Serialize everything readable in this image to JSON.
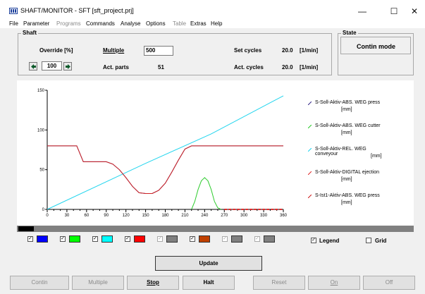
{
  "window": {
    "title": "SHAFT/MONITOR - SFT  [sft_project.prj]",
    "minimize": "—",
    "maximize": "☐",
    "close": "✕"
  },
  "menu": [
    {
      "label": "File",
      "enabled": true
    },
    {
      "label": "Parameter",
      "enabled": true
    },
    {
      "label": "Programs",
      "enabled": false
    },
    {
      "label": "Commands",
      "enabled": true
    },
    {
      "label": "Analyse",
      "enabled": true
    },
    {
      "label": "Options",
      "enabled": true
    },
    {
      "label": "Table",
      "enabled": false
    },
    {
      "label": "Extras",
      "enabled": true
    },
    {
      "label": "Help",
      "enabled": true
    }
  ],
  "shaft": {
    "group_label": "Shaft",
    "override_label": "Override [%]",
    "override_value": "100",
    "multiple_label": "Multiple",
    "multiple_value": "500",
    "act_parts_label": "Act. parts",
    "act_parts_value": "51",
    "set_cycles_label": "Set cycles",
    "set_cycles_value": "20.0",
    "set_cycles_unit": "[1/min]",
    "act_cycles_label": "Act. cycles",
    "act_cycles_value": "20.0",
    "act_cycles_unit": "[1/min]"
  },
  "state": {
    "group_label": "State",
    "value": "Contin mode"
  },
  "chart_data": {
    "type": "line",
    "xlim": [
      0,
      360
    ],
    "ylim": [
      0,
      150
    ],
    "x_ticks": [
      "0",
      "30",
      "60",
      "90",
      "120",
      "150",
      "180",
      "210",
      "240",
      "270",
      "300",
      "330",
      "360"
    ],
    "y_ticks": [
      "0",
      "50",
      "100",
      "150"
    ],
    "grid": false,
    "legend_position": "right",
    "series": [
      {
        "name": "S-Soll-Aktiv-ABS. WEG press",
        "unit": "[mm]",
        "color": "#3a2e8c",
        "x": [
          0,
          45,
          55,
          90,
          100,
          110,
          120,
          130,
          140,
          150,
          160,
          170,
          180,
          190,
          200,
          210,
          220,
          360
        ],
        "y": [
          80,
          80,
          60,
          60,
          57,
          50,
          40,
          29,
          21,
          20,
          20,
          24,
          33,
          47,
          62,
          76,
          80,
          80
        ]
      },
      {
        "name": "S-Soll-Aktiv-ABS. WEG cutter",
        "unit": "[mm]",
        "color": "#2ecc2e",
        "x": [
          220,
          225,
          230,
          235,
          240,
          245,
          250,
          255,
          260,
          265
        ],
        "y": [
          0,
          10,
          25,
          36,
          40,
          36,
          25,
          10,
          2,
          0
        ]
      },
      {
        "name": "S-Soll-Aktiv-REL. WEG conveyour",
        "unit": "[mm]",
        "color": "#22d5ee",
        "x": [
          0,
          150,
          250,
          360
        ],
        "y": [
          0,
          58,
          95,
          143
        ]
      },
      {
        "name": "S-Soll-Aktiv-DIGITAL ejection",
        "unit": "[mm]",
        "color": "#e03030",
        "x": [
          0,
          360
        ],
        "y": [
          0,
          0
        ]
      },
      {
        "name": "S-Ist1-Aktiv-ABS. WEG press",
        "unit": "[mm]",
        "color": "#d02020",
        "x": [
          0,
          45,
          55,
          90,
          100,
          110,
          120,
          130,
          140,
          150,
          160,
          170,
          180,
          190,
          200,
          210,
          220,
          360
        ],
        "y": [
          80,
          80,
          60,
          60,
          57,
          50,
          40,
          29,
          21,
          20,
          20,
          24,
          33,
          47,
          62,
          76,
          80,
          80
        ]
      }
    ]
  },
  "channels": [
    {
      "checked": true,
      "enabled": true,
      "color": "#0000ff"
    },
    {
      "checked": true,
      "enabled": true,
      "color": "#00ff00"
    },
    {
      "checked": true,
      "enabled": true,
      "color": "#00ffff"
    },
    {
      "checked": true,
      "enabled": true,
      "color": "#ff0000"
    },
    {
      "checked": true,
      "enabled": false,
      "color": "#808080"
    },
    {
      "checked": true,
      "enabled": true,
      "color": "#c04000"
    },
    {
      "checked": true,
      "enabled": false,
      "color": "#808080"
    },
    {
      "checked": true,
      "enabled": false,
      "color": "#808080"
    }
  ],
  "options": {
    "legend_label": "Legend",
    "legend_checked": true,
    "grid_label": "Grid",
    "grid_checked": false
  },
  "buttons": {
    "update": "Update",
    "contin": "Contin",
    "multiple": "Multiple",
    "stop": "Stop",
    "halt": "Halt",
    "reset": "Reset",
    "on": "On",
    "off": "Off"
  }
}
